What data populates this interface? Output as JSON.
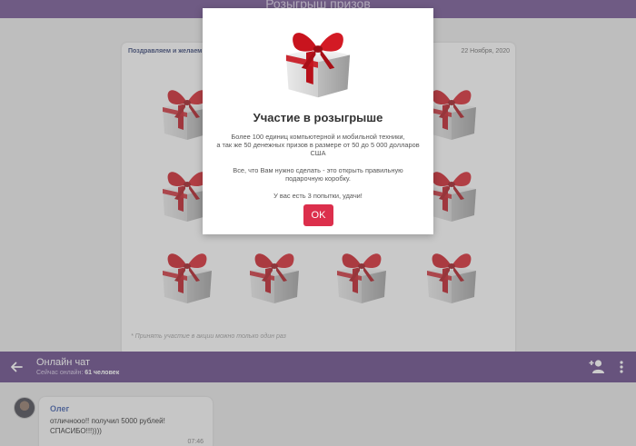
{
  "page": {
    "title": "Розыгрыш призов"
  },
  "card": {
    "header": "Поздравляем и желаем уд",
    "date": "22 Ноября, 2020",
    "footnote": "* Принять участие в акции можно только один раз",
    "gift_count": 12
  },
  "modal": {
    "title": "Участие в розыгрыше",
    "line1": "Более 100 единиц компьютерной и мобильной техники,",
    "line2": "а так же 50 денежных призов в размере от 50 до 5 000 долларов",
    "line3": "США",
    "line4": "Все, что Вам нужно сделать - это открыть правильную",
    "line5": "подарочную коробку.",
    "line6": "У вас есть 3 попытки, удачи!",
    "ok_label": "OK"
  },
  "chat": {
    "title": "Онлайн чат",
    "online_label": "Сейчас онлайн:",
    "online_count": "61 человек",
    "messages": [
      {
        "author": "Олег",
        "line1": "отличнооо!! получил 5000 рублей!",
        "line2": "СПАСИБО!!!))))",
        "time": "07:46"
      }
    ]
  },
  "icons": {
    "back": "arrow-left-icon",
    "add_user": "add-user-icon",
    "more": "more-vertical-icon",
    "gift": "gift-box-icon"
  },
  "colors": {
    "header_purple": "#5c3d80",
    "ok_button": "#dc2f4c",
    "ribbon_red": "#c8141e"
  }
}
